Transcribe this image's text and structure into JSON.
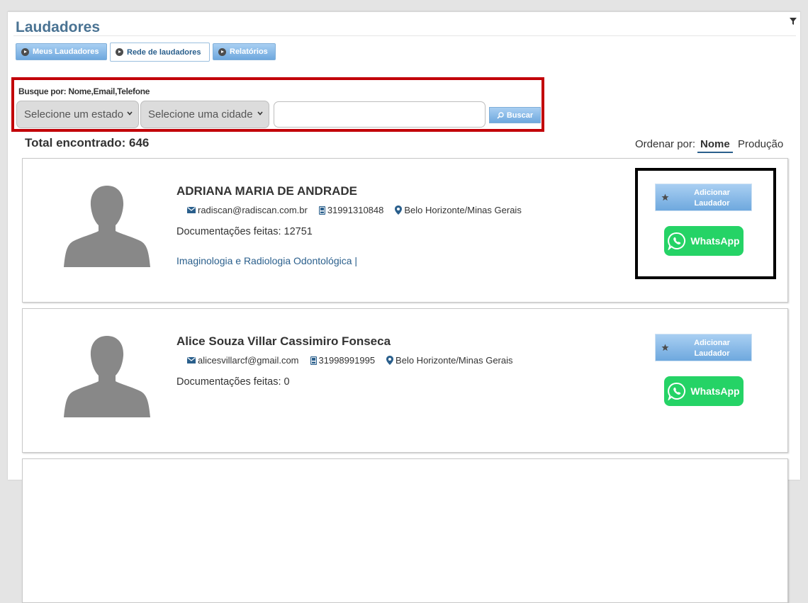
{
  "page": {
    "title": "Laudadores"
  },
  "tabs": [
    {
      "label": "Meus Laudadores",
      "active": false
    },
    {
      "label": "Rede de laudadores",
      "active": true
    },
    {
      "label": "Relatórios",
      "active": false
    }
  ],
  "search": {
    "label": "Busque por: Nome,Email,Telefone",
    "state_select": "Selecione um estado",
    "city_select": "Selecione uma cidade",
    "query_value": "",
    "button_label": "Buscar"
  },
  "results": {
    "total_label": "Total encontrado: 646",
    "order_label": "Ordenar por:",
    "order_options": [
      "Nome",
      "Produção"
    ],
    "order_selected": "Nome"
  },
  "cards": [
    {
      "name": "ADRIANA MARIA DE ANDRADE",
      "email": "radiscan@radiscan.com.br",
      "phone": "31991310848",
      "location": "Belo Horizonte/Minas Gerais",
      "docs": "Documentações feitas: 12751",
      "specialty": "Imaginologia e Radiologia Odontológica   |",
      "add_label": "Adicionar Laudador",
      "whatsapp_label": "WhatsApp"
    },
    {
      "name": "Alice Souza Villar Cassimiro Fonseca",
      "email": "alicesvillarcf@gmail.com",
      "phone": "31998991995",
      "location": "Belo Horizonte/Minas Gerais",
      "docs": "Documentações feitas: 0",
      "specialty": "",
      "add_label": "Adicionar Laudador",
      "whatsapp_label": "WhatsApp"
    }
  ],
  "colors": {
    "title": "#4a7393",
    "tab_gradient_top": "#a9cff2",
    "tab_gradient_bottom": "#6ea8de",
    "highlight_red": "#c20008",
    "whatsapp_green": "#25d366",
    "link_blue": "#2a5f8c"
  }
}
